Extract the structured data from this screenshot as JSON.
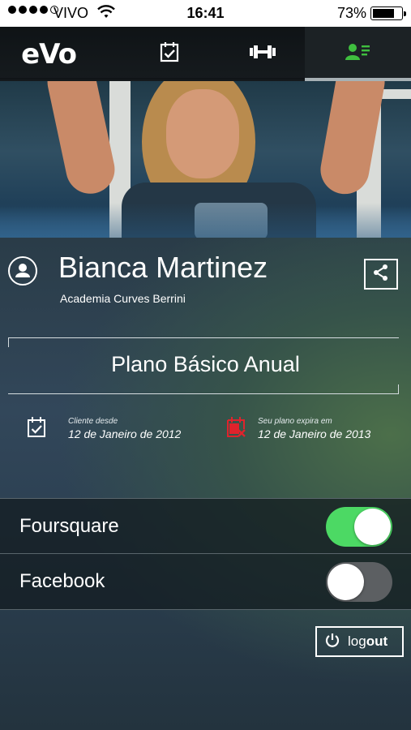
{
  "status_bar": {
    "carrier": "VIVO",
    "time": "16:41",
    "battery": "73%",
    "battery_level": 0.73,
    "signal_bars": 4,
    "signal_max": 5
  },
  "nav": {
    "logo": "eVo",
    "tabs": [
      {
        "icon": "calendar-check-icon",
        "active": false
      },
      {
        "icon": "dumbbell-icon",
        "active": false
      },
      {
        "icon": "profile-list-icon",
        "active": true
      }
    ],
    "active_color": "#3fbf3f"
  },
  "profile": {
    "name": "Bianca Martinez",
    "gym": "Academia Curves Berrini"
  },
  "plan": {
    "name": "Plano Básico Anual",
    "client_since_label": "Cliente desde",
    "client_since_value": "12 de Janeiro de 2012",
    "expires_label": "Seu plano expira em",
    "expires_value": "12 de Janeiro de 2013",
    "expires_icon_color": "#e0232c"
  },
  "social": [
    {
      "label": "Foursquare",
      "enabled": true
    },
    {
      "label": "Facebook",
      "enabled": false
    }
  ],
  "logout": {
    "prefix": "log",
    "suffix": "out"
  }
}
